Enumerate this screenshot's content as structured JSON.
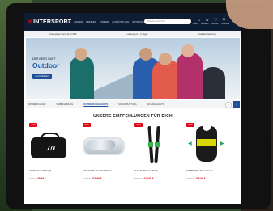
{
  "brand": "INTERSPORT",
  "nav": [
    "ALLE",
    "DAMEN",
    "HERREN",
    "KINDER",
    "AUSRÜSTUNG",
    "SPORTARTEN",
    "MARKEN",
    "SALE"
  ],
  "search_placeholder": "Wonach suchst du?",
  "header_icon_labels": [
    "Filialen",
    "Anmelden",
    "Merkliste",
    "Warenkorb"
  ],
  "promo": [
    "Kostenloser Versand ab 50 €",
    "Lieferung in 1-3 Tagen",
    "Kauf auf Rechnung"
  ],
  "hero": {
    "subtitle": "DER BERG RUFT",
    "title": "Outdoor",
    "button": "Zur Kollektion"
  },
  "categories": [
    "WANDERSCHUHE",
    "SKIBEKLEIDUNG",
    "OUTDOOR HIGHLIGHTS",
    "SKIAUSRÜSTUNG",
    "SKI HIGHLIGHTS"
  ],
  "categories_active_index": 2,
  "section_title": "UNSERE EMPFEHLUNGEN FÜR DICH",
  "products": [
    {
      "badge": "-15%",
      "name": "ADIDAS Tiro Duffelbag M",
      "old_price": "34,99 €",
      "price": "29,99 €",
      "icon": "duffel-bag"
    },
    {
      "badge": "-20%",
      "name": "UVEX Skibrille Downhill 2000 FM",
      "old_price": "149,99 €",
      "price": "119,99 €",
      "icon": "ski-goggles"
    },
    {
      "badge": "-20%",
      "name": "ELAN Ski Wingman 86 CTi",
      "old_price": "599,99 €",
      "price": "449,99 €",
      "icon": "skis"
    },
    {
      "badge": "-25%",
      "name": "KOMPERDELL Protektorweste",
      "old_price": "149,99 €",
      "price": "119,99 €",
      "icon": "protector-vest"
    }
  ],
  "colors": {
    "header": "#0e1d33",
    "accent": "#1f4f96",
    "sale": "#e30613"
  }
}
